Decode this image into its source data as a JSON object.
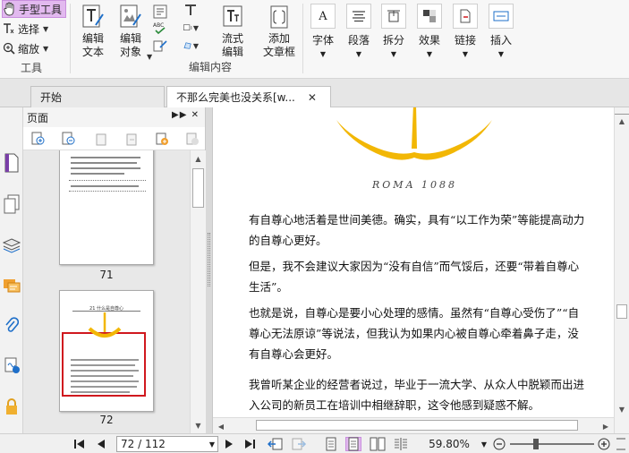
{
  "ribbon": {
    "tools": {
      "hand_tool": "手型工具",
      "select": "选择",
      "zoom": "缩放",
      "group_label": "工具"
    },
    "edit": {
      "edit_text": "编辑\n文本",
      "edit_object": "编辑\n对象",
      "flow_edit": "流式\n编辑",
      "add_textbox": "添加\n文章框",
      "group_label": "编辑内容"
    },
    "format": {
      "font": "字体",
      "paragraph": "段落",
      "split": "拆分",
      "effect": "效果",
      "link": "链接",
      "insert": "插入"
    }
  },
  "tabs": [
    {
      "label": "开始"
    },
    {
      "label": "不那么完美也没关系[w..."
    }
  ],
  "pages_panel": {
    "title": "页面",
    "thumb1": {
      "number": "71"
    },
    "thumb2": {
      "number": "72",
      "heading": "21  什么是自尊心"
    }
  },
  "document": {
    "roma_text": "ROMA 1088",
    "paragraphs": [
      "有自尊心地活着是世间美德。确实，具有“以工作为荣”等能提高动力的自尊心更好。",
      "但是，我不会建议大家因为“没有自信”而气馁后，还要“带着自尊心生活”。",
      "也就是说，自尊心是要小心处理的感情。虽然有“自尊心受伤了”“自尊心无法原谅”等说法，但我认为如果内心被自尊心牵着鼻子走，没有自尊心会更好。",
      "我曾听某企业的经营者说过，毕业于一流大学、从众人中脱颖而出进入公司的新员工在培训中相继辞职，这令他感到疑惑不解。"
    ]
  },
  "status": {
    "page_field": "72 / 112",
    "zoom_level": "59.80%"
  },
  "colors": {
    "accent_purple": "#e2b9ef",
    "anchor_yellow": "#f2b705",
    "selection_red": "#d0181e"
  }
}
